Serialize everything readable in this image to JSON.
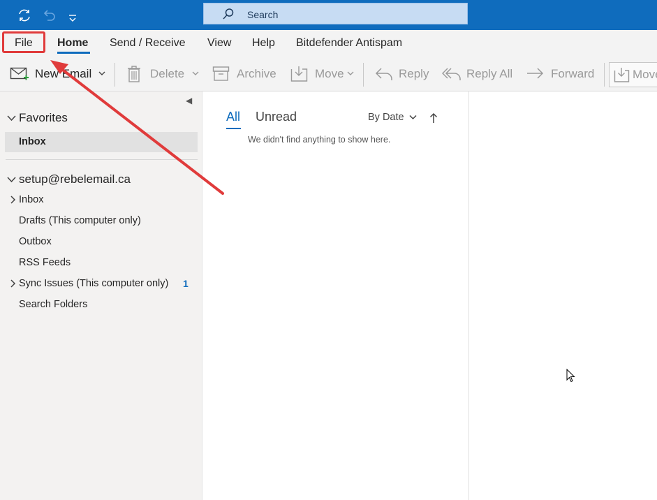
{
  "search": {
    "label": "Search"
  },
  "menu": {
    "file": "File",
    "home": "Home",
    "send_receive": "Send / Receive",
    "view": "View",
    "help": "Help",
    "bitdefender": "Bitdefender Antispam"
  },
  "ribbon": {
    "new_email": "New Email",
    "delete": "Delete",
    "archive": "Archive",
    "move": "Move",
    "reply": "Reply",
    "reply_all": "Reply All",
    "forward": "Forward",
    "move2": "Move"
  },
  "folders": {
    "favorites": "Favorites",
    "fav_inbox": "Inbox",
    "account": "setup@rebelemail.ca",
    "items": [
      {
        "label": "Inbox"
      },
      {
        "label": "Drafts (This computer only)"
      },
      {
        "label": "Outbox"
      },
      {
        "label": "RSS Feeds"
      },
      {
        "label": "Sync Issues (This computer only)",
        "count": "1"
      },
      {
        "label": "Search Folders"
      }
    ]
  },
  "list": {
    "tab_all": "All",
    "tab_unread": "Unread",
    "sort": "By Date",
    "empty": "We didn't find anything to show here."
  },
  "colors": {
    "accent": "#0f6cbd",
    "annotation": "#e03b3b"
  }
}
